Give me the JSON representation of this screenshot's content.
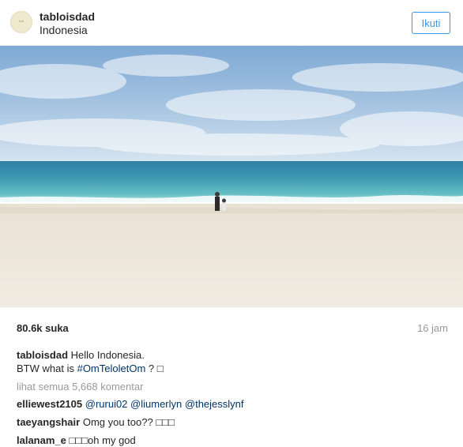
{
  "header": {
    "username": "tabloisdad",
    "location": "Indonesia",
    "follow_label": "Ikuti"
  },
  "post": {
    "likes": "80.6k suka",
    "time": "16 jam",
    "caption": {
      "user": "tabloisdad",
      "line1": "Hello Indonesia.",
      "line2_prefix": "BTW what is",
      "hashtag": "#OmTeloletOm",
      "line2_suffix": "? □"
    },
    "view_all": "lihat semua 5,668 komentar",
    "comments": [
      {
        "user": "elliewest2105",
        "mentions": [
          "@rurui02",
          "@liumerlyn",
          "@thejesslynf"
        ],
        "text": ""
      },
      {
        "user": "taeyangshair",
        "text": "Omg you too?? □□□"
      },
      {
        "user": "lalanam_e",
        "text": "□□□oh my god"
      }
    ]
  },
  "colors": {
    "accent": "#3897f0",
    "link": "#003569",
    "muted": "#999999",
    "text": "#262626"
  },
  "icons": {
    "avatar": "profile-picture"
  }
}
